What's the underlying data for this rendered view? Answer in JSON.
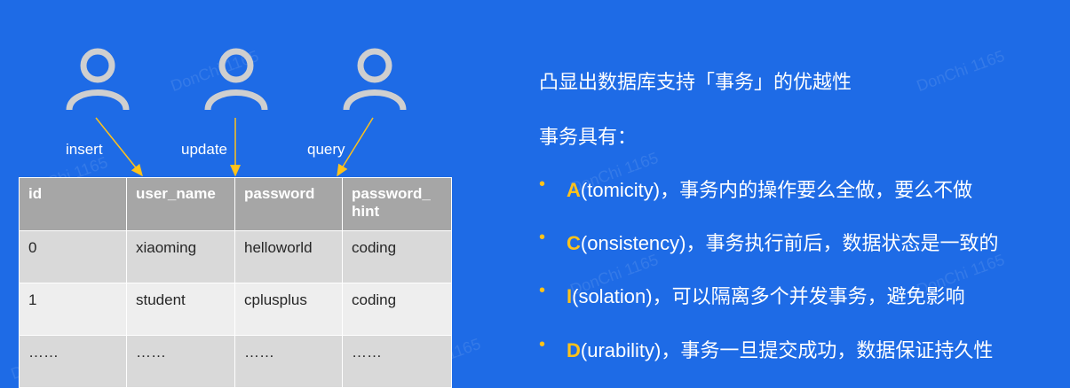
{
  "users": [
    {
      "icon": "user-icon",
      "label": "insert"
    },
    {
      "icon": "user-icon",
      "label": "update"
    },
    {
      "icon": "user-icon",
      "label": "query"
    }
  ],
  "table": {
    "headers": [
      "id",
      "user_name",
      "password",
      "password_\nhint"
    ],
    "rows": [
      [
        "0",
        "xiaoming",
        "helloworld",
        "coding"
      ],
      [
        "1",
        "student",
        "cplusplus",
        "coding"
      ],
      [
        "……",
        "……",
        "……",
        "……"
      ]
    ]
  },
  "right": {
    "heading": "凸显出数据库支持「事务」的优越性",
    "subheading": "事务具有：",
    "bullets": [
      {
        "letter": "A",
        "rest": "(tomicity)，事务内的操作要么全做，要么不做"
      },
      {
        "letter": "C",
        "rest": "(onsistency)，事务执行前后，数据状态是一致的"
      },
      {
        "letter": "I",
        "rest": "(solation)，可以隔离多个并发事务，避免影响"
      },
      {
        "letter": "D",
        "rest": "(urability)，事务一旦提交成功，数据保证持久性"
      }
    ],
    "bullet_symbol": "•"
  },
  "watermark": "DonChi 1165",
  "colors": {
    "background": "#1e6be6",
    "accent": "#ffc21a",
    "header": "#a6a6a6",
    "row_odd": "#d9d9d9",
    "row_even": "#eeeeee",
    "icon": "#cfcfcf"
  }
}
